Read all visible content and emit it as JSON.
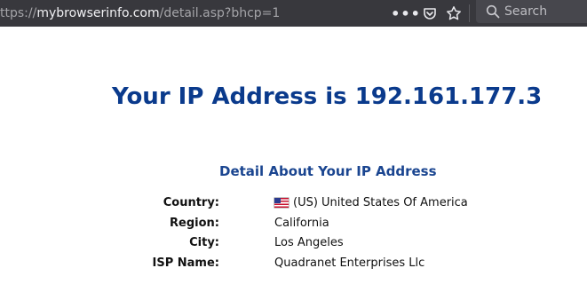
{
  "browser": {
    "url_scheme_partial": "ttps://",
    "url_host": "mybrowserinfo.com",
    "url_path": "/detail.asp?bhcp=1",
    "search_placeholder": "Search",
    "icons": [
      "more-actions-icon",
      "pocket-icon",
      "bookmark-star-icon",
      "search-icon"
    ]
  },
  "page": {
    "headline": "Your IP Address is 192.161.177.3",
    "subtitle": "Detail About Your IP Address",
    "details": [
      {
        "label": "Country:",
        "value": "(US) United States Of America",
        "icon": "us-flag-icon"
      },
      {
        "label": "Region:",
        "value": "California"
      },
      {
        "label": "City:",
        "value": "Los Angeles"
      },
      {
        "label": "ISP Name:",
        "value": "Quadranet Enterprises Llc"
      }
    ]
  },
  "colors": {
    "toolbar_bg": "#38383d",
    "headline": "#0a3a8c",
    "subtitle": "#1a4590"
  }
}
